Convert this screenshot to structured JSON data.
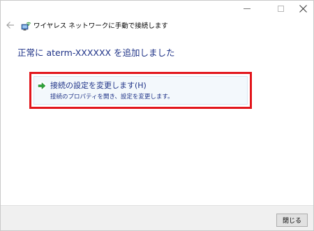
{
  "window": {
    "minimize_icon": "minimize-icon",
    "maximize_icon": "maximize-icon",
    "close_icon": "close-icon"
  },
  "header": {
    "back_icon": "back-arrow-icon",
    "network_icon": "wireless-network-icon",
    "title": "ワイヤレス ネットワークに手動で接続します"
  },
  "main": {
    "message": "正常に aterm-XXXXXX を追加しました",
    "command_link": {
      "icon": "green-arrow-icon",
      "title": "接続の設定を変更します(H)",
      "description": "接続のプロパティを開き、設定を変更します。"
    },
    "highlight_color": "#e2151b"
  },
  "footer": {
    "close_label": "閉じる"
  }
}
